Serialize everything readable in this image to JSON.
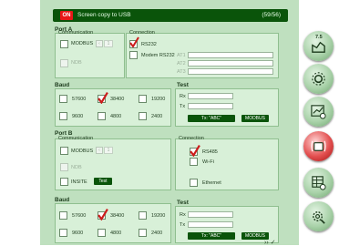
{
  "topbar": {
    "status": "ON",
    "message": "Screen copy to USB",
    "count": "(59/56)"
  },
  "port_a": {
    "title": "Port A",
    "communication": {
      "title": "Communication",
      "modbus": "MODBUS",
      "modbus_value": "1",
      "ndb": "NDB"
    },
    "connection": {
      "title": "Connection",
      "rs232": "RS232",
      "modem_rs232": "Modem RS232",
      "at1": "AT1",
      "at2": "AT2",
      "at3": "AT3"
    },
    "baud": {
      "title": "Baud",
      "options": [
        "57600",
        "38400",
        "19200",
        "9600",
        "4800",
        "2400"
      ],
      "selected": "38400"
    },
    "test": {
      "title": "Test",
      "rx": "Rx",
      "tx": "Tx",
      "tx_abc": "Tx: \"ABC\"",
      "modbus": "MODBUS"
    }
  },
  "port_b": {
    "title": "Port B",
    "communication": {
      "title": "Communication",
      "modbus": "MODBUS",
      "modbus_value": "1",
      "ndb": "NDB",
      "insite": "INSITE",
      "test_button": "Test"
    },
    "connection": {
      "title": "Connection",
      "rs485": "RS485",
      "wifi": "Wi-Fi",
      "ethernet": "Ethernet"
    },
    "baud": {
      "title": "Baud",
      "options": [
        "57600",
        "38400",
        "19200",
        "9600",
        "4800",
        "2400"
      ],
      "selected": "38400"
    },
    "test": {
      "title": "Test",
      "rx": "Rx",
      "tx": "Tx",
      "tx_abc": "Tx: \"ABC\"",
      "modbus": "MODBUS"
    }
  },
  "sidebar": {
    "version_label": "7.5"
  },
  "colors": {
    "accent": "#0a540a",
    "panel": "#bfe0bf",
    "alert": "#e81818"
  }
}
